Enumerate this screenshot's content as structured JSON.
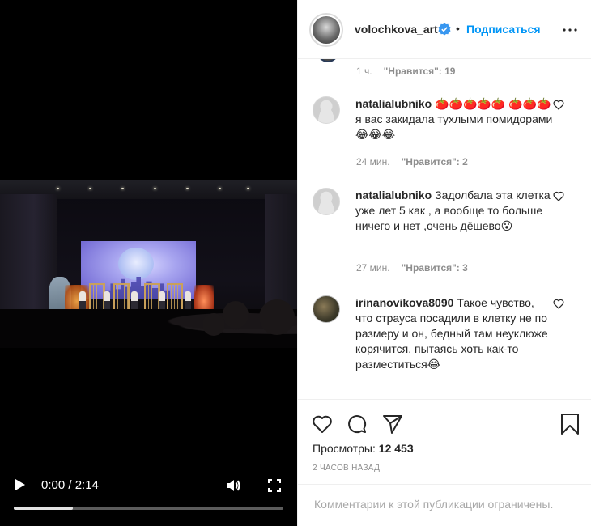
{
  "video": {
    "time": "0:00 / 2:14",
    "progress_fraction": 0.22
  },
  "header": {
    "username": "volochkova_art",
    "separator": "•",
    "follow_label": "Подписаться"
  },
  "comments": {
    "top_meta": {
      "time": "1 ч.",
      "likes": "\"Нравится\": 19"
    },
    "items": [
      {
        "user": "natalialubniko",
        "text": "🍅🍅🍅🍅🍅 🍅🍅🍅я вас закидала тухлыми помидорами😂😂😂",
        "time": "24 мин.",
        "likes": "\"Нравится\": 2"
      },
      {
        "user": "natalialubniko",
        "text": "Задолбала эта клетка уже лет 5 как , а вообще то больше ничего и нет ,очень дёшево😮",
        "time": "27 мин.",
        "likes": "\"Нравится\": 3"
      },
      {
        "user": "irinanovikova8090",
        "text": "Такое чувство, что страуса посадили в клетку не по размеру и он, бедный там неуклюже корячится, пытаясь хоть как-то разместиться😂"
      }
    ]
  },
  "actions": {
    "views_label": "Просмотры:",
    "views_count": "12 453",
    "posted": "2 ЧАСОВ НАЗАД"
  },
  "footer": {
    "limited_text": "Комментарии к этой публикации ограничены."
  },
  "colors": {
    "accent": "#0095f6",
    "verified": "#3897f0"
  }
}
